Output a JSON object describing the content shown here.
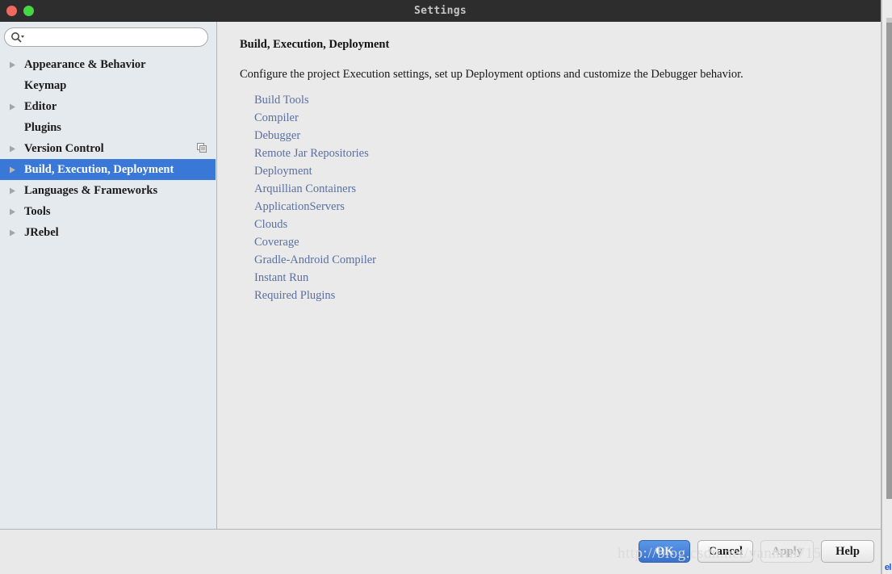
{
  "window": {
    "title": "Settings",
    "traffic_lights": [
      {
        "name": "close",
        "color": "#ed6a5e"
      },
      {
        "name": "maximize",
        "color": "#45d845"
      }
    ]
  },
  "search": {
    "placeholder": "",
    "value": "",
    "icon": "search-icon",
    "dropdown_icon": "chevron-down-icon"
  },
  "sidebar": {
    "items": [
      {
        "label": "Appearance & Behavior",
        "expandable": true,
        "selected": false,
        "icon": null
      },
      {
        "label": "Keymap",
        "expandable": false,
        "selected": false,
        "icon": null
      },
      {
        "label": "Editor",
        "expandable": true,
        "selected": false,
        "icon": null
      },
      {
        "label": "Plugins",
        "expandable": false,
        "selected": false,
        "icon": null
      },
      {
        "label": "Version Control",
        "expandable": true,
        "selected": false,
        "icon": "copy-pages-icon"
      },
      {
        "label": "Build, Execution, Deployment",
        "expandable": true,
        "selected": true,
        "icon": null
      },
      {
        "label": "Languages & Frameworks",
        "expandable": true,
        "selected": false,
        "icon": null
      },
      {
        "label": "Tools",
        "expandable": true,
        "selected": false,
        "icon": null
      },
      {
        "label": "JRebel",
        "expandable": true,
        "selected": false,
        "icon": null
      }
    ]
  },
  "content": {
    "title": "Build, Execution, Deployment",
    "description": "Configure the project Execution settings, set up Deployment options and customize the Debugger behavior.",
    "links": [
      "Build Tools",
      "Compiler",
      "Debugger",
      "Remote Jar Repositories",
      "Deployment",
      "Arquillian Containers",
      "ApplicationServers",
      "Clouds",
      "Coverage",
      "Gradle-Android Compiler",
      "Instant Run",
      "Required Plugins"
    ]
  },
  "footer": {
    "watermark": "http://blog.csdn.net/yanmin715",
    "buttons": [
      {
        "label": "OK",
        "style": "primary",
        "enabled": true
      },
      {
        "label": "Cancel",
        "style": "default",
        "enabled": true
      },
      {
        "label": "Apply",
        "style": "disabled",
        "enabled": false
      },
      {
        "label": "Help",
        "style": "default",
        "enabled": true
      }
    ]
  },
  "background": {
    "corner_text": "el"
  },
  "colors": {
    "selection": "#3a78d8",
    "link": "#5a6fa0",
    "titlebar": "#2d2d2d",
    "sidebar_bg": "#e4eaee",
    "content_bg": "#eaeaea"
  }
}
